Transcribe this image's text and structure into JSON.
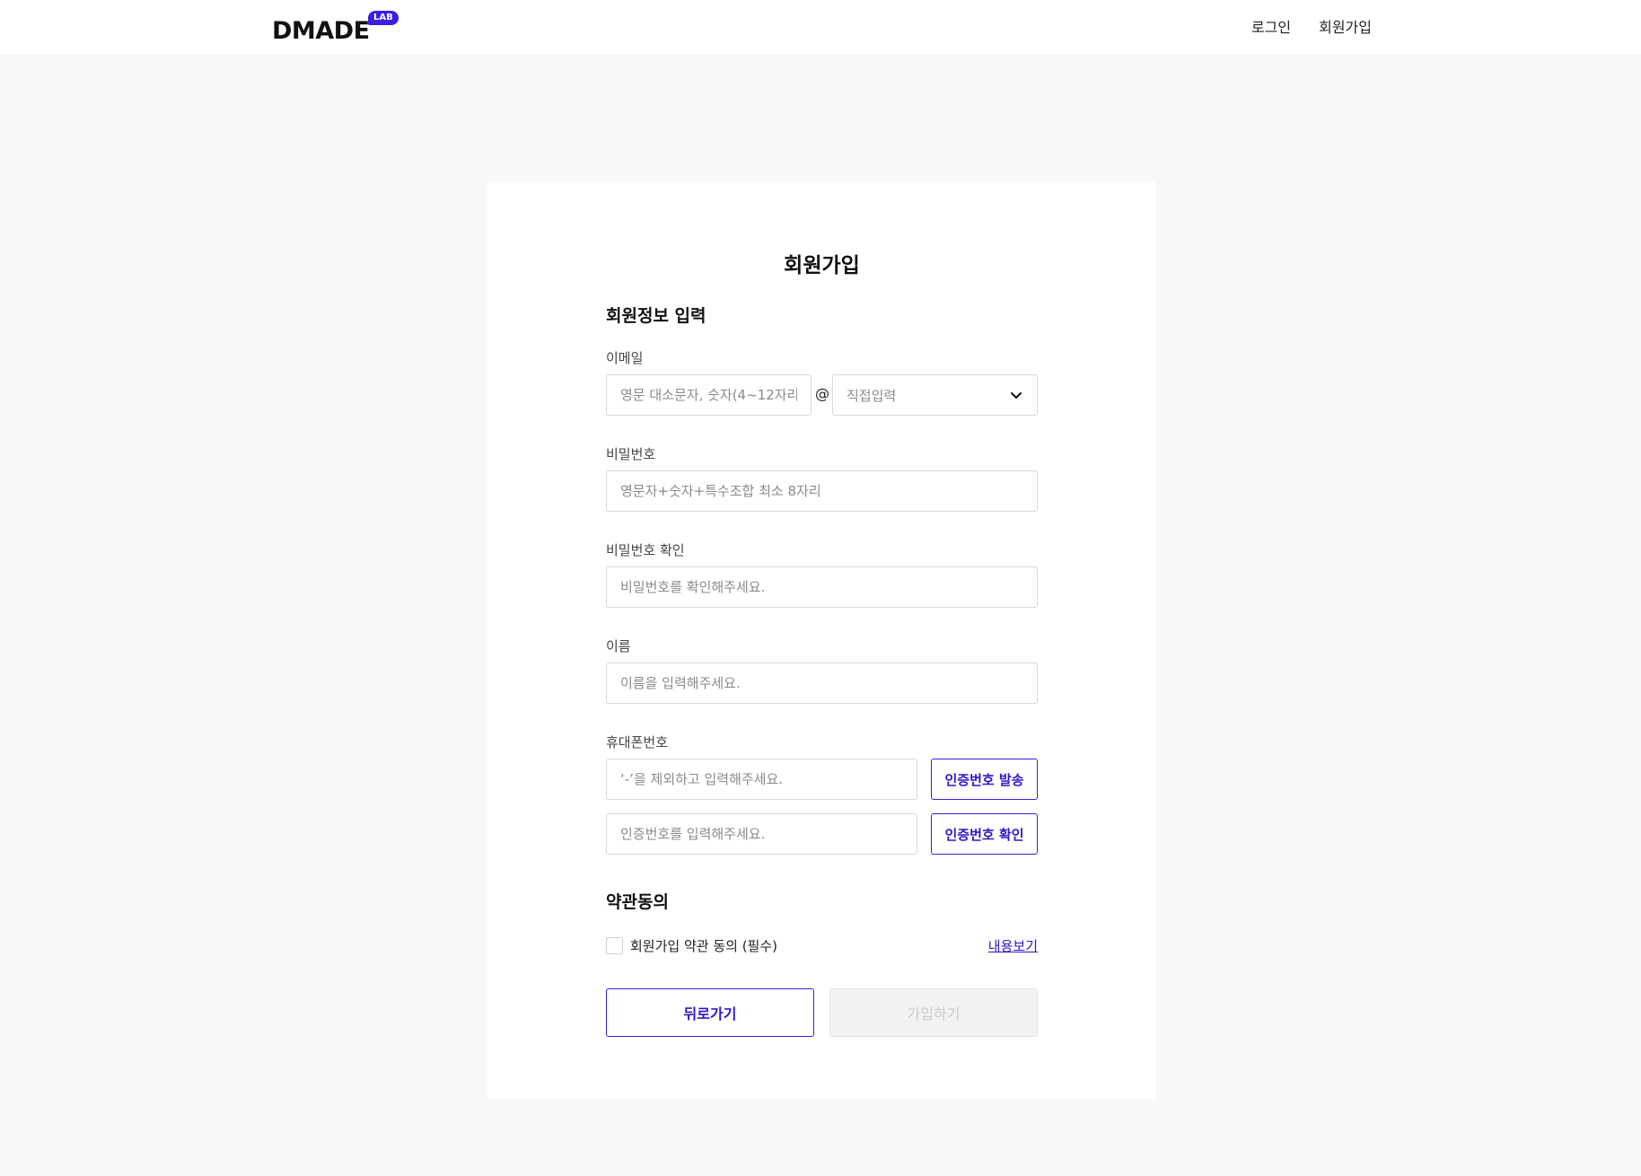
{
  "header": {
    "logo_text": "DMADE",
    "logo_badge": "LAB",
    "nav": {
      "login": "로그인",
      "signup": "회원가입"
    }
  },
  "form": {
    "title": "회원가입",
    "info_section": "회원정보 입력",
    "email": {
      "label": "이메일",
      "placeholder": "영문 대소문자, 숫자(4~12자리)",
      "at": "@",
      "domain_selected": "직접입력"
    },
    "password": {
      "label": "비밀번호",
      "placeholder": "영문자+숫자+특수조합 최소 8자리"
    },
    "password_confirm": {
      "label": "비밀번호 확인",
      "placeholder": "비밀번호를 확인해주세요."
    },
    "name": {
      "label": "이름",
      "placeholder": "이름을 입력해주세요."
    },
    "phone": {
      "label": "휴대폰번호",
      "placeholder": "‘-’을 제외하고 입력해주세요.",
      "send_button": "인증번호 발송",
      "code_placeholder": "인증번호를 입력해주세요.",
      "verify_button": "인증번호 확인"
    },
    "terms": {
      "section": "약관동의",
      "agree_label": "회원가입 약관 동의 (필수)",
      "view_link": "내용보기"
    },
    "buttons": {
      "back": "뒤로가기",
      "submit": "가입하기"
    }
  },
  "colors": {
    "accent": "#3b1fe0",
    "page_bg": "#f7f8fa",
    "disabled_bg": "#f2f2f2"
  }
}
